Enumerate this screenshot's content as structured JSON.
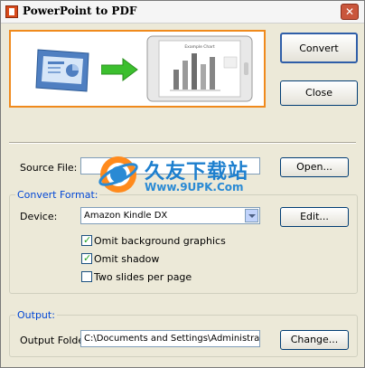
{
  "window": {
    "title": "PowerPoint to PDF",
    "close_glyph": "✕"
  },
  "banner": {
    "pdf_chart_title": "Example Chart"
  },
  "buttons": {
    "convert": "Convert",
    "close": "Close",
    "open": "Open...",
    "edit": "Edit...",
    "change": "Change..."
  },
  "source": {
    "label": "Source File:",
    "value": ""
  },
  "convert_format": {
    "legend": "Convert Format:",
    "device_label": "Device:",
    "device_value": "Amazon Kindle DX",
    "options": [
      {
        "label": "Omit background graphics",
        "checked": true
      },
      {
        "label": "Omit shadow",
        "checked": true
      },
      {
        "label": "Two slides per page",
        "checked": false
      }
    ]
  },
  "output": {
    "legend": "Output:",
    "folder_label": "Output Folder:",
    "folder_value": "C:\\Documents and Settings\\Administrator.MICR"
  },
  "watermark": {
    "text": "久友下载站",
    "url": "Www.9UPK.Com"
  },
  "colors": {
    "accent_border": "#f08a1c",
    "window_bg": "#ece9d8",
    "legend_blue": "#0046d5"
  }
}
